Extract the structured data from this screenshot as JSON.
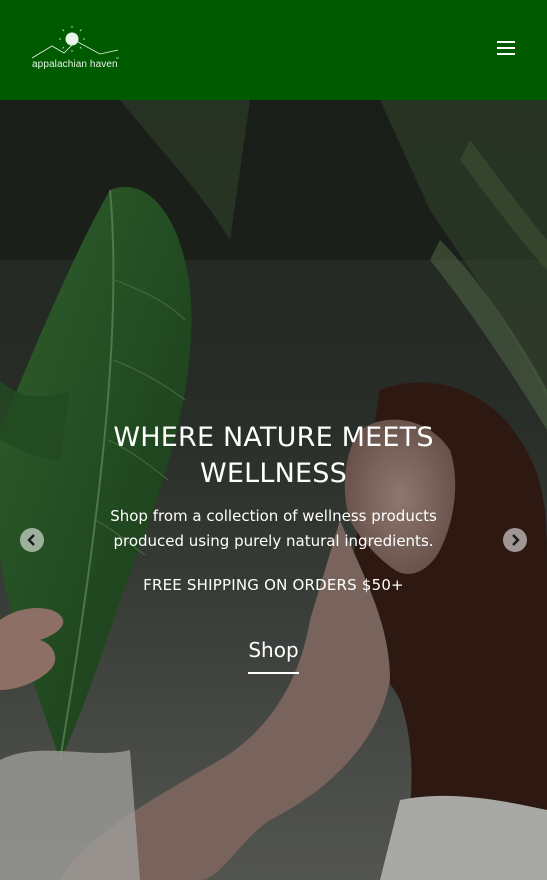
{
  "header": {
    "logo_text": "appalachian haven",
    "logo_tm": "™",
    "menu_icon": "hamburger-icon",
    "bg_color": "#005a00"
  },
  "hero": {
    "title": "WHERE NATURE MEETS WELLNESS",
    "subtitle": "Shop from a collection of wellness products produced using purely natural ingredients.",
    "shipping": "FREE SHIPPING ON ORDERS $50+",
    "cta_label": "Shop",
    "prev_icon": "chevron-left-icon",
    "next_icon": "chevron-right-icon"
  }
}
